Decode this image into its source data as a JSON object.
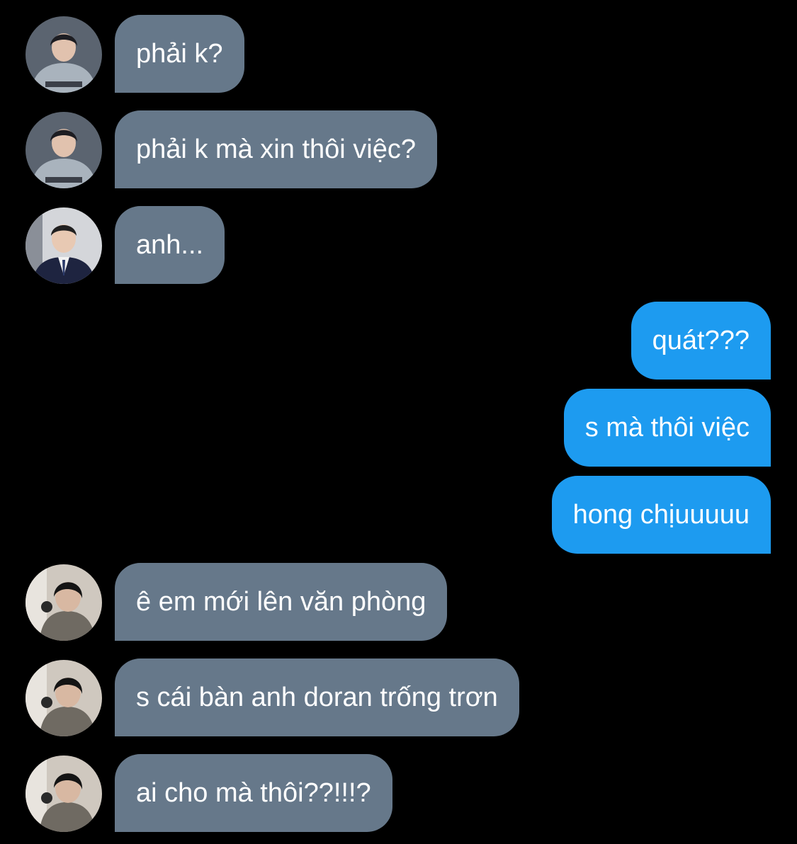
{
  "colors": {
    "background": "#000000",
    "incoming_bubble": "#66788a",
    "outgoing_bubble": "#1d9bf0",
    "text": "#ffffff"
  },
  "messages": [
    {
      "direction": "incoming",
      "sender_avatar": "avatar-grey-hoodie-photo",
      "text": "phải k?"
    },
    {
      "direction": "incoming",
      "sender_avatar": "avatar-grey-hoodie-photo",
      "text": "phải k mà xin thôi việc?"
    },
    {
      "direction": "incoming",
      "sender_avatar": "avatar-suit-photo",
      "text": "anh..."
    },
    {
      "direction": "outgoing",
      "text": "quát???"
    },
    {
      "direction": "outgoing",
      "text": "s mà thôi việc"
    },
    {
      "direction": "outgoing",
      "text": "hong chịuuuuu"
    },
    {
      "direction": "incoming",
      "sender_avatar": "avatar-headset-photo",
      "text": "ê em mới lên văn phòng"
    },
    {
      "direction": "incoming",
      "sender_avatar": "avatar-headset-photo",
      "text": "s cái bàn anh doran trống trơn"
    },
    {
      "direction": "incoming",
      "sender_avatar": "avatar-headset-photo",
      "text": "ai cho mà thôi??!!!?"
    }
  ]
}
